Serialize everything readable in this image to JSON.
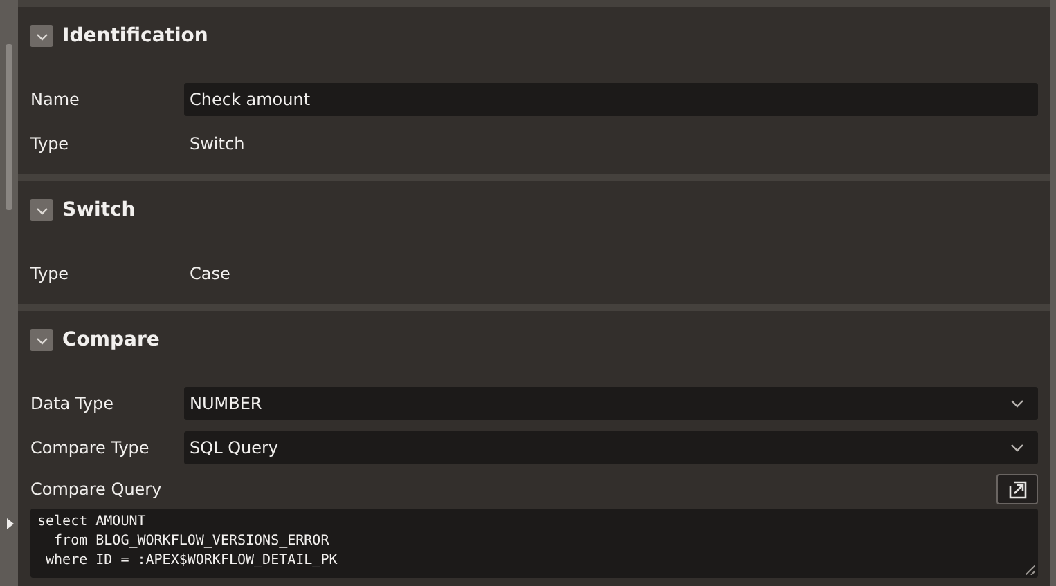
{
  "sections": [
    {
      "title": "Identification",
      "expanded": true,
      "rows": [
        {
          "kind": "input",
          "label": "Name",
          "value": "Check amount"
        },
        {
          "kind": "static",
          "label": "Type",
          "value": "Switch"
        }
      ]
    },
    {
      "title": "Switch",
      "expanded": true,
      "rows": [
        {
          "kind": "static",
          "label": "Type",
          "value": "Case"
        }
      ]
    },
    {
      "title": "Compare",
      "expanded": true,
      "rows": [
        {
          "kind": "select",
          "label": "Data Type",
          "value": "NUMBER"
        },
        {
          "kind": "select",
          "label": "Compare Type",
          "value": "SQL Query"
        },
        {
          "kind": "code",
          "label": "Compare Query",
          "lines": [
            "select AMOUNT",
            "  from BLOG_WORKFLOW_VERSIONS_ERROR",
            " where ID = :APEX$WORKFLOW_DETAIL_PK"
          ]
        }
      ]
    }
  ]
}
